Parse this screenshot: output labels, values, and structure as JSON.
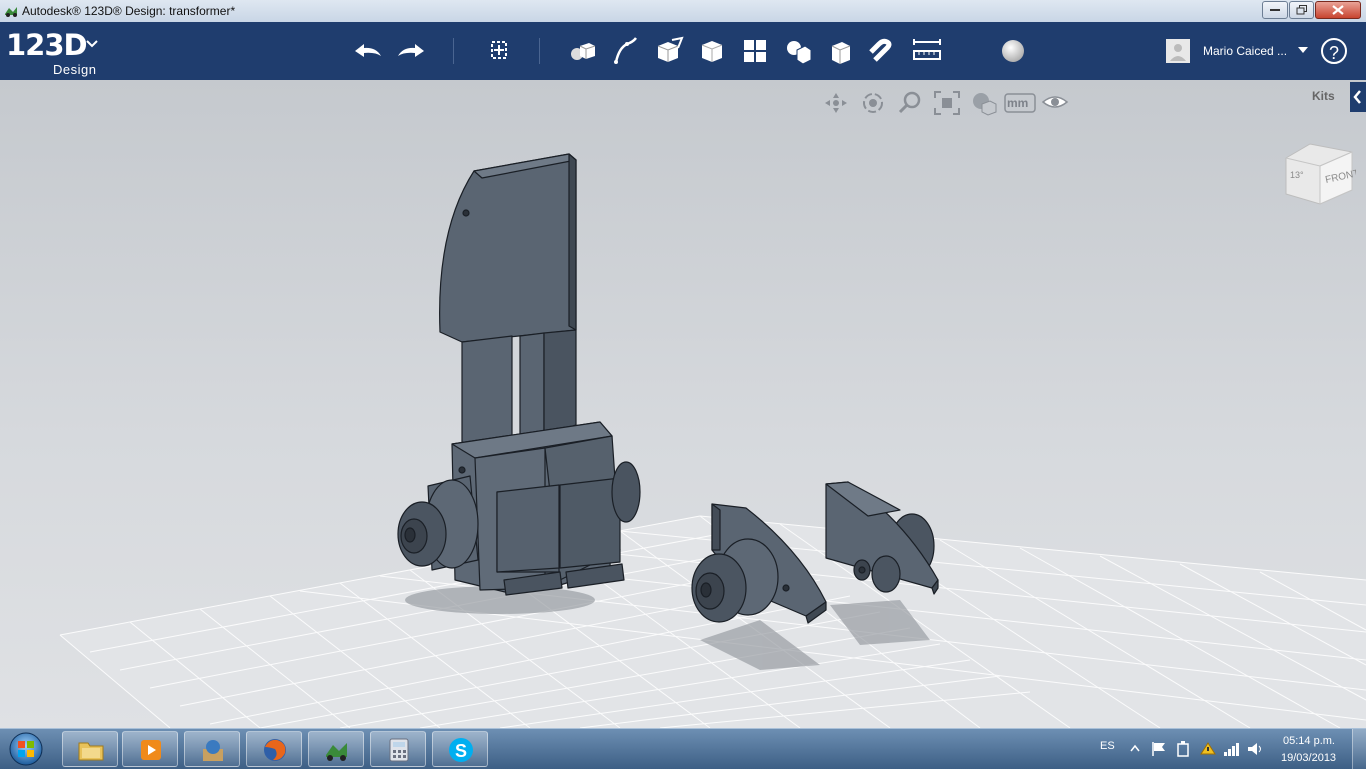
{
  "window": {
    "title": "Autodesk® 123D® Design: transformer*",
    "controls": [
      "minimize",
      "maximize",
      "close"
    ]
  },
  "app": {
    "logo_main": "123D",
    "logo_sub": "Design",
    "brand_color": "#1f3d6e"
  },
  "toolbar": {
    "tools": [
      "undo-icon",
      "redo-icon",
      "transform-icon",
      "primitives-icon",
      "sketch-icon",
      "construct-icon",
      "modify-icon",
      "pattern-icon",
      "grouping-icon",
      "combine-icon",
      "snap-icon",
      "measure-icon",
      "material-icon"
    ]
  },
  "user": {
    "name": "Mario Caiced ..."
  },
  "help": {
    "label": "?"
  },
  "viewport": {
    "nav_tools": [
      "pan-icon",
      "orbit-icon",
      "zoom-icon",
      "fit-icon",
      "view-style-icon",
      "units-icon",
      "visibility-icon"
    ],
    "units_label": "mm",
    "kits_label": "Kits",
    "viewcube_label": "FRONT",
    "viewcube_side_label": "13°"
  },
  "taskbar": {
    "apps": [
      "windows-explorer",
      "media-player",
      "123d-catch",
      "firefox",
      "123d-design",
      "calculator",
      "skype"
    ],
    "language": "ES",
    "time": "05:14 p.m.",
    "date": "19/03/2013"
  }
}
